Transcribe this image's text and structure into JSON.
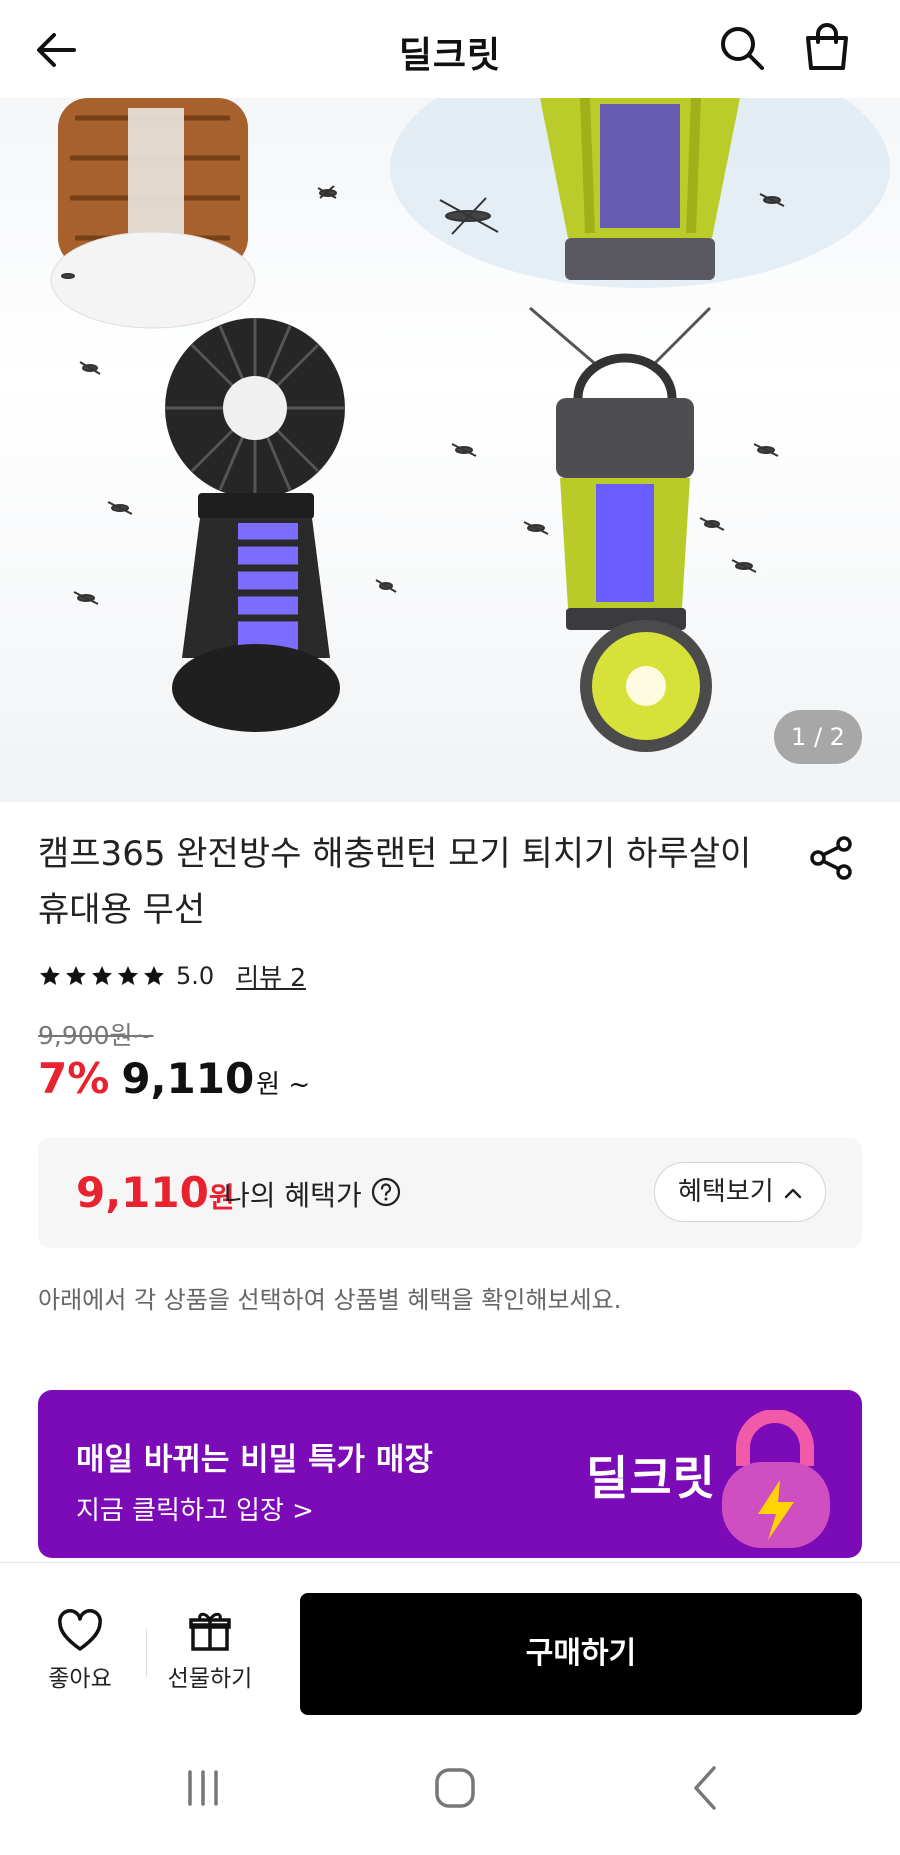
{
  "header": {
    "title": "딜크릿",
    "back_icon": "arrow-left-icon",
    "search_icon": "search-icon",
    "cart_icon": "shopping-bag-icon"
  },
  "hero": {
    "page_indicator": "1 / 2"
  },
  "product": {
    "title": "캠프365 완전방수 해충랜턴 모기 퇴치기 하루살이 휴대용 무선",
    "rating_value": "5.0",
    "star_count": 5,
    "review_link": "리뷰 2",
    "original_price": "9,900원~",
    "discount": "7%",
    "sale_price": "9,110",
    "sale_unit": "원 ~"
  },
  "benefit": {
    "price": "9,110",
    "unit": "원",
    "label": "나의 혜택가",
    "button": "혜택보기"
  },
  "notice": "아래에서 각 상품을 선택하여 상품별 혜택을 확인해보세요.",
  "banner": {
    "title": "매일 바뀌는 비밀 특가 매장",
    "subtitle": "지금 클릭하고 입장 >",
    "logo": "딜크릿"
  },
  "bottom_bar": {
    "like_label": "좋아요",
    "gift_label": "선물하기",
    "buy_label": "구매하기"
  },
  "colors": {
    "accent_red": "#e8222e",
    "banner_purple": "#7a0bb6",
    "buy_button": "#000000"
  }
}
